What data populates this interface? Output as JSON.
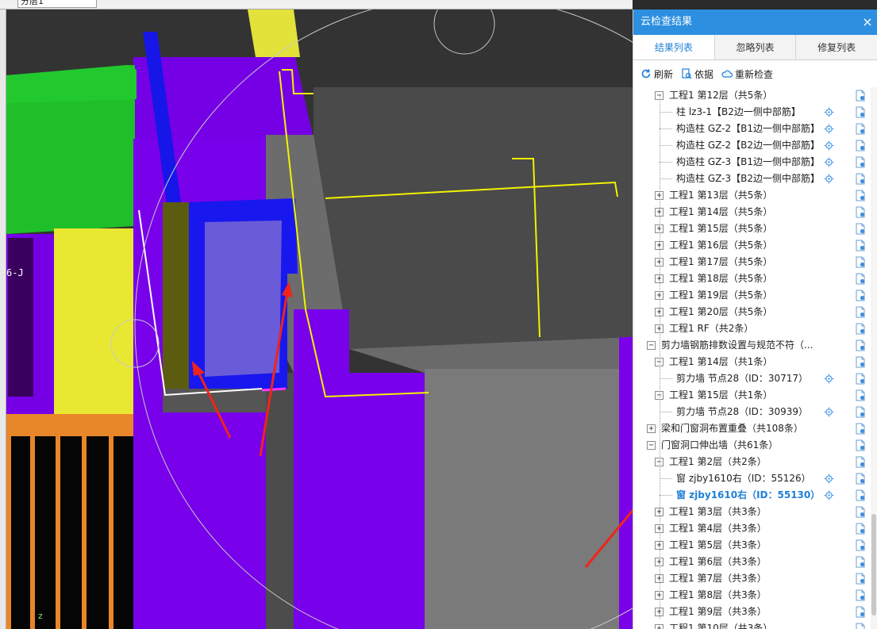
{
  "topbar": {
    "floor_select": "分层1",
    "grid_label": "6-J",
    "axis_label": "z"
  },
  "panel": {
    "title": "云检查结果",
    "close": "×",
    "tabs": [
      "结果列表",
      "忽略列表",
      "修复列表"
    ],
    "active_tab": 0,
    "toolbar": {
      "refresh": "刷新",
      "basis": "依据",
      "recheck": "重新检查"
    },
    "rows": [
      {
        "level": 1,
        "toggle": "−",
        "label": "工程1 第12层（共5条）"
      },
      {
        "level": 2,
        "label": "柱 lz3-1【B2边一侧中部筋】",
        "loc": true
      },
      {
        "level": 2,
        "label": "构造柱 GZ-2【B1边一侧中部筋】",
        "loc": true
      },
      {
        "level": 2,
        "label": "构造柱 GZ-2【B2边一侧中部筋】",
        "loc": true
      },
      {
        "level": 2,
        "label": "构造柱 GZ-3【B1边一侧中部筋】",
        "loc": true
      },
      {
        "level": 2,
        "label": "构造柱 GZ-3【B2边一侧中部筋】",
        "loc": true
      },
      {
        "level": 1,
        "toggle": "+",
        "label": "工程1 第13层（共5条）"
      },
      {
        "level": 1,
        "toggle": "+",
        "label": "工程1 第14层（共5条）"
      },
      {
        "level": 1,
        "toggle": "+",
        "label": "工程1 第15层（共5条）"
      },
      {
        "level": 1,
        "toggle": "+",
        "label": "工程1 第16层（共5条）"
      },
      {
        "level": 1,
        "toggle": "+",
        "label": "工程1 第17层（共5条）"
      },
      {
        "level": 1,
        "toggle": "+",
        "label": "工程1 第18层（共5条）"
      },
      {
        "level": 1,
        "toggle": "+",
        "label": "工程1 第19层（共5条）"
      },
      {
        "level": 1,
        "toggle": "+",
        "label": "工程1 第20层（共5条）"
      },
      {
        "level": 1,
        "toggle": "+",
        "label": "工程1 RF（共2条）"
      },
      {
        "level": 0,
        "toggle": "−",
        "label": "剪力墙钢筋排数设置与规范不符（..."
      },
      {
        "level": 1,
        "toggle": "−",
        "label": "工程1 第14层（共1条）"
      },
      {
        "level": 2,
        "label": "剪力墙 节点28（ID：30717）",
        "loc": true
      },
      {
        "level": 1,
        "toggle": "−",
        "label": "工程1 第15层（共1条）"
      },
      {
        "level": 2,
        "label": "剪力墙 节点28（ID：30939）",
        "loc": true
      },
      {
        "level": 0,
        "toggle": "+",
        "label": "梁和门窗洞布置重叠（共108条）"
      },
      {
        "level": 0,
        "toggle": "−",
        "label": "门窗洞口伸出墙（共61条）"
      },
      {
        "level": 1,
        "toggle": "−",
        "label": "工程1 第2层（共2条）"
      },
      {
        "level": 2,
        "label": "窗 zjby1610右（ID：55126）",
        "loc": true
      },
      {
        "level": 2,
        "label": "窗 zjby1610右（ID：55130）",
        "loc": true,
        "selected": true
      },
      {
        "level": 1,
        "toggle": "+",
        "label": "工程1 第3层（共3条）"
      },
      {
        "level": 1,
        "toggle": "+",
        "label": "工程1 第4层（共3条）"
      },
      {
        "level": 1,
        "toggle": "+",
        "label": "工程1 第5层（共3条）"
      },
      {
        "level": 1,
        "toggle": "+",
        "label": "工程1 第6层（共3条）"
      },
      {
        "level": 1,
        "toggle": "+",
        "label": "工程1 第7层（共3条）"
      },
      {
        "level": 1,
        "toggle": "+",
        "label": "工程1 第8层（共3条）"
      },
      {
        "level": 1,
        "toggle": "+",
        "label": "工程1 第9层（共3条）"
      },
      {
        "level": 1,
        "toggle": "+",
        "label": "工程1 第10层（共3条）"
      }
    ]
  },
  "colors": {
    "header": "#2d8fe0",
    "accent": "#1e7fd6",
    "purple": "#7a00e8",
    "blue": "#1414e6",
    "green": "#1fbf2a",
    "yellow": "#e8e832",
    "orange": "#e8862a",
    "olive": "#5c5c10",
    "gray": "#646464",
    "arrow": "#f0241a"
  }
}
